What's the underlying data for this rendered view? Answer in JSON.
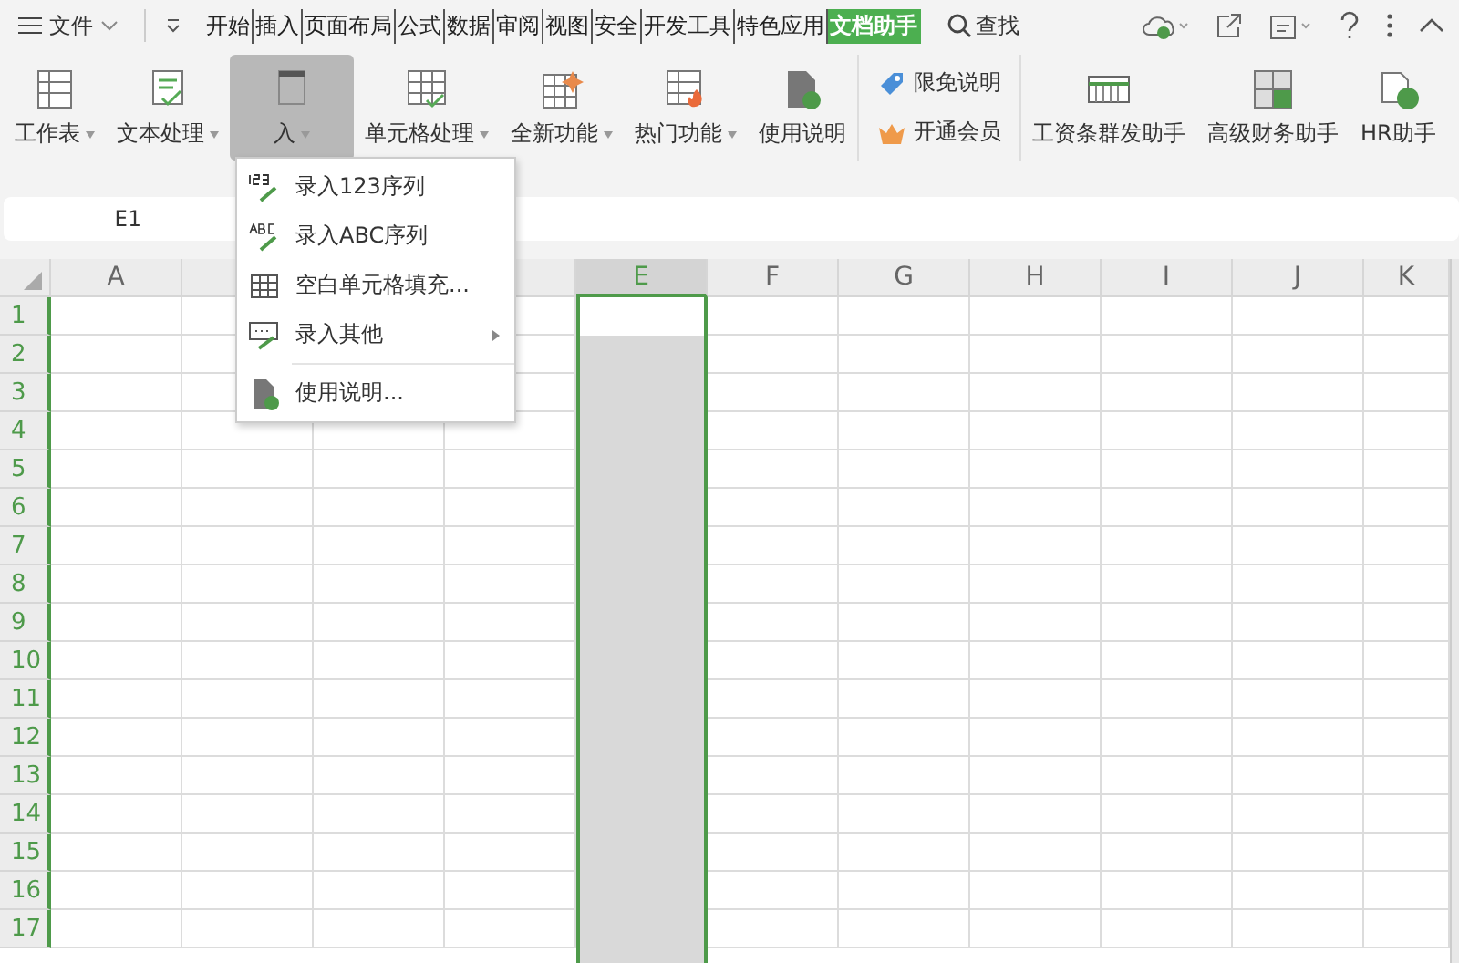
{
  "menu_bar": {
    "menu_label": "文件",
    "tabs": [
      {
        "label": "开始",
        "selected": false
      },
      {
        "label": "插入",
        "selected": false
      },
      {
        "label": "页面布局",
        "selected": false
      },
      {
        "label": "公式",
        "selected": false
      },
      {
        "label": "数据",
        "selected": false
      },
      {
        "label": "审阅",
        "selected": false
      },
      {
        "label": "视图",
        "selected": false
      },
      {
        "label": "安全",
        "selected": false
      },
      {
        "label": "开发工具",
        "selected": false
      },
      {
        "label": "特色应用",
        "selected": false
      },
      {
        "label": "文档助手",
        "selected": true
      }
    ],
    "search": "查找"
  },
  "ribbon": {
    "groups": [
      {
        "kind": "large",
        "items": [
          {
            "label": "工作表",
            "dropdown": true,
            "pressed": false
          },
          {
            "label": "文本处理",
            "dropdown": true,
            "pressed": false
          },
          {
            "label": "入",
            "dropdown": true,
            "pressed": true
          },
          {
            "label": "单元格处理",
            "dropdown": true,
            "pressed": false
          },
          {
            "label": "全新功能",
            "dropdown": true,
            "pressed": false
          },
          {
            "label": "热门功能",
            "dropdown": true,
            "pressed": false
          },
          {
            "label": "使用说明",
            "dropdown": false,
            "pressed": false
          }
        ]
      },
      {
        "kind": "small",
        "items": [
          {
            "label": "限免说明"
          },
          {
            "label": "开通会员"
          }
        ]
      },
      {
        "kind": "large",
        "items": [
          {
            "label": "工资条群发助手",
            "dropdown": false,
            "pressed": false
          },
          {
            "label": "高级财务助手",
            "dropdown": false,
            "pressed": false
          },
          {
            "label": "HR助手",
            "dropdown": false,
            "pressed": false
          }
        ]
      }
    ]
  },
  "dropdown_menu": {
    "items": [
      {
        "kind": "item",
        "label": "录入123序列",
        "submenu": false
      },
      {
        "kind": "item",
        "label": "录入ABC序列",
        "submenu": false
      },
      {
        "kind": "item",
        "label": "空白单元格填充...",
        "submenu": false
      },
      {
        "kind": "item",
        "label": "录入其他",
        "submenu": true
      },
      {
        "kind": "separator"
      },
      {
        "kind": "item",
        "label": "使用说明...",
        "submenu": false
      }
    ]
  },
  "name_box": "E1",
  "sheet": {
    "columns": [
      {
        "label": "A",
        "selected": false
      },
      {
        "label": "E",
        "selected": true
      },
      {
        "label": "F",
        "selected": false
      },
      {
        "label": "G",
        "selected": false
      },
      {
        "label": "H",
        "selected": false
      },
      {
        "label": "I",
        "selected": false
      },
      {
        "label": "J",
        "selected": false
      },
      {
        "label": "K",
        "selected": false
      }
    ],
    "rows": [
      "1",
      "2",
      "3",
      "4",
      "5",
      "6",
      "7",
      "8",
      "9",
      "10",
      "11",
      "12",
      "13",
      "14",
      "15",
      "16",
      "17"
    ]
  }
}
